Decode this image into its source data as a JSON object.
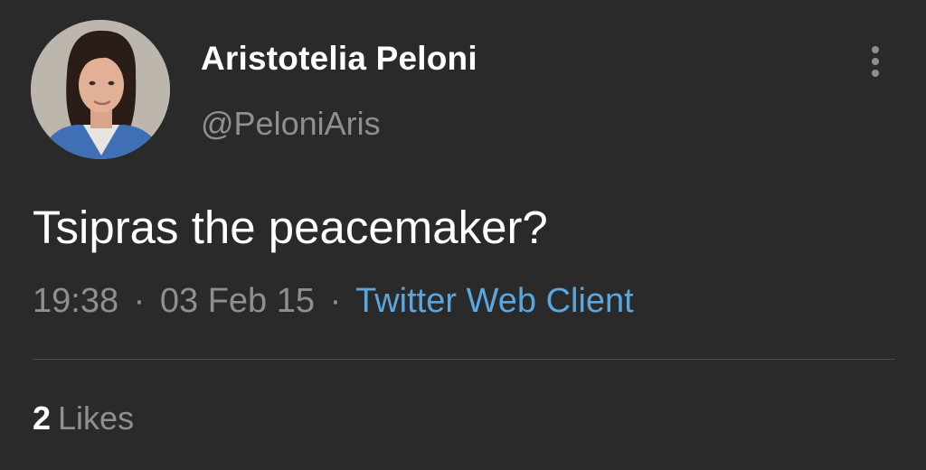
{
  "tweet": {
    "author": {
      "display_name": "Aristotelia Peloni",
      "handle": "@PeloniAris",
      "avatar_icon": "profile-photo"
    },
    "text": "Tsipras the peacemaker?",
    "meta": {
      "time": "19:38",
      "date": "03 Feb 15",
      "separator": "·",
      "source": "Twitter Web Client"
    },
    "likes": {
      "count": "2",
      "label": "Likes"
    },
    "more_icon": "more-vertical-icon"
  },
  "colors": {
    "background": "#2b2a2b",
    "primary_text": "#ffffff",
    "secondary_text": "#8f8f91",
    "link": "#5aa7e0",
    "divider": "#4a494b"
  }
}
